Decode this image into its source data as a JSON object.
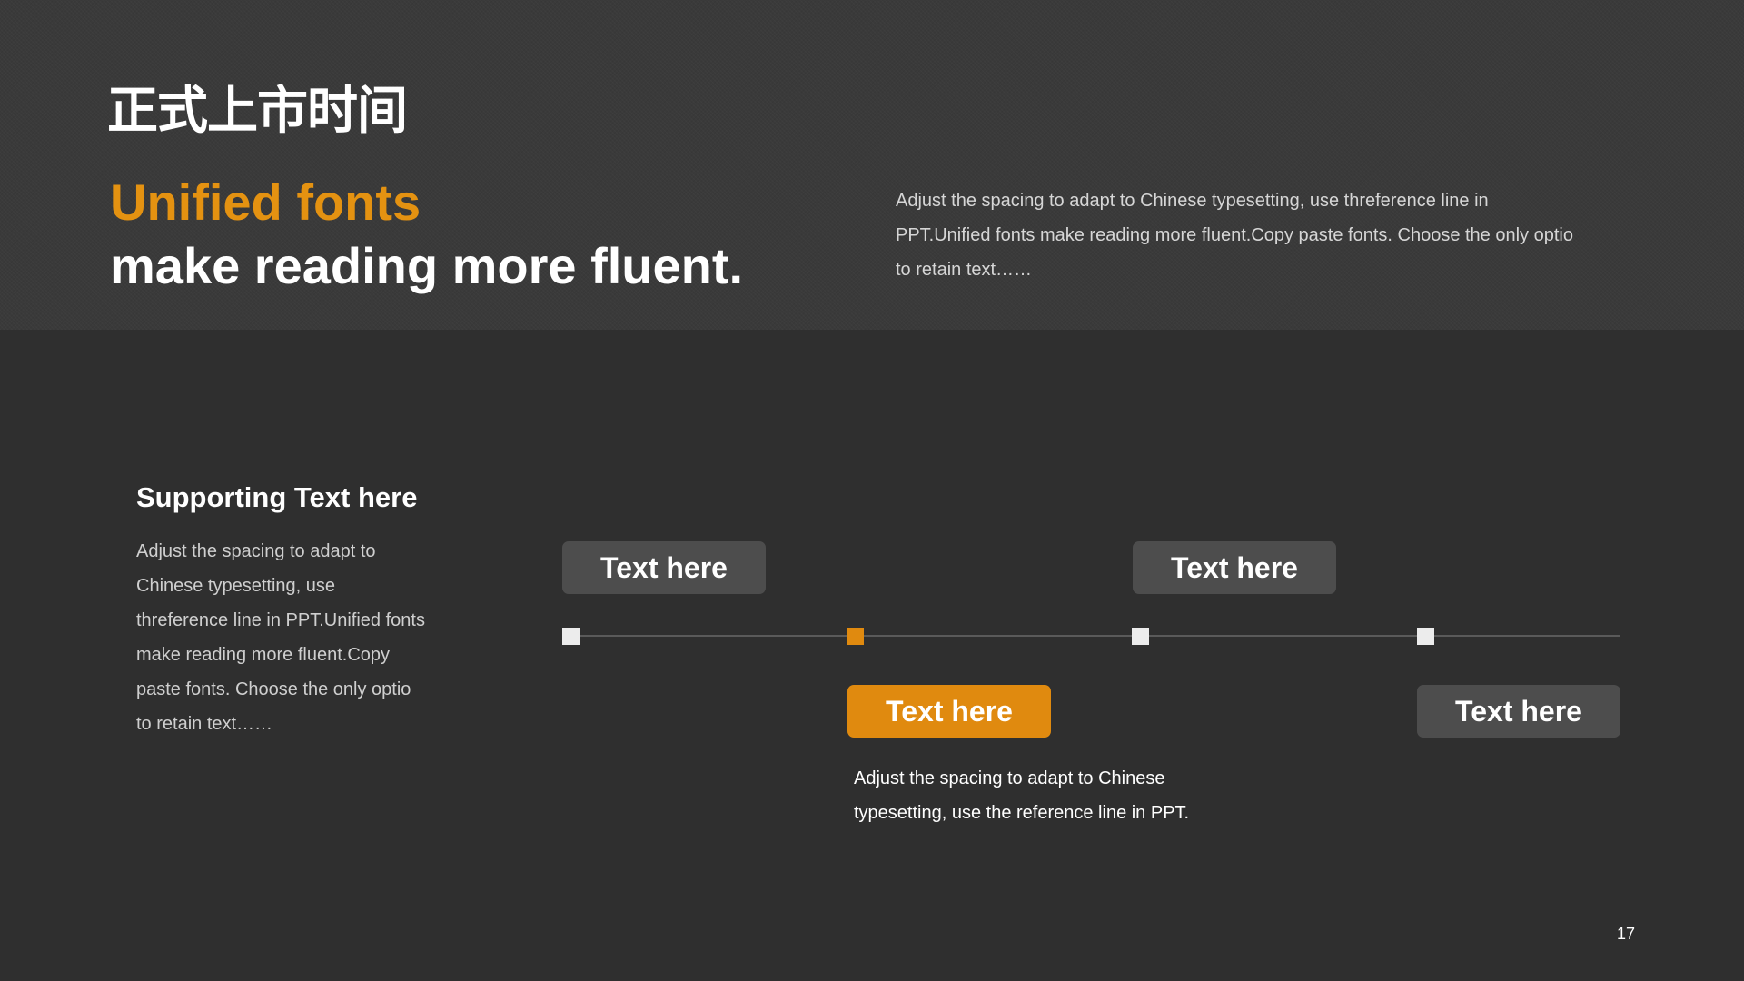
{
  "header": {
    "cn_title": "正式上市时间",
    "headline_accent": "Unified fonts",
    "headline_main": "make reading more fluent.",
    "description": "Adjust the spacing to adapt to Chinese typesetting, use threference line in PPT.Unified fonts make reading more fluent.Copy paste fonts. Choose the only optio to retain text……"
  },
  "support": {
    "title": "Supporting Text here",
    "body": "Adjust the spacing to adapt to Chinese typesetting, use threference line in PPT.Unified fonts make reading more fluent.Copy paste fonts. Choose the only optio to retain text……"
  },
  "timeline": {
    "items": [
      {
        "label": "Text here",
        "position": "above",
        "active": false
      },
      {
        "label": "Text here",
        "position": "below",
        "active": true
      },
      {
        "label": "Text here",
        "position": "above",
        "active": false
      },
      {
        "label": "Text here",
        "position": "below",
        "active": false
      }
    ],
    "active_description": "Adjust the spacing to adapt to Chinese typesetting, use the reference line in PPT."
  },
  "colors": {
    "accent": "#e08a0f",
    "background": "#2f2f2f",
    "header_background": "#3a3a3a",
    "label_background": "#4d4d4d"
  },
  "page_number": "17"
}
